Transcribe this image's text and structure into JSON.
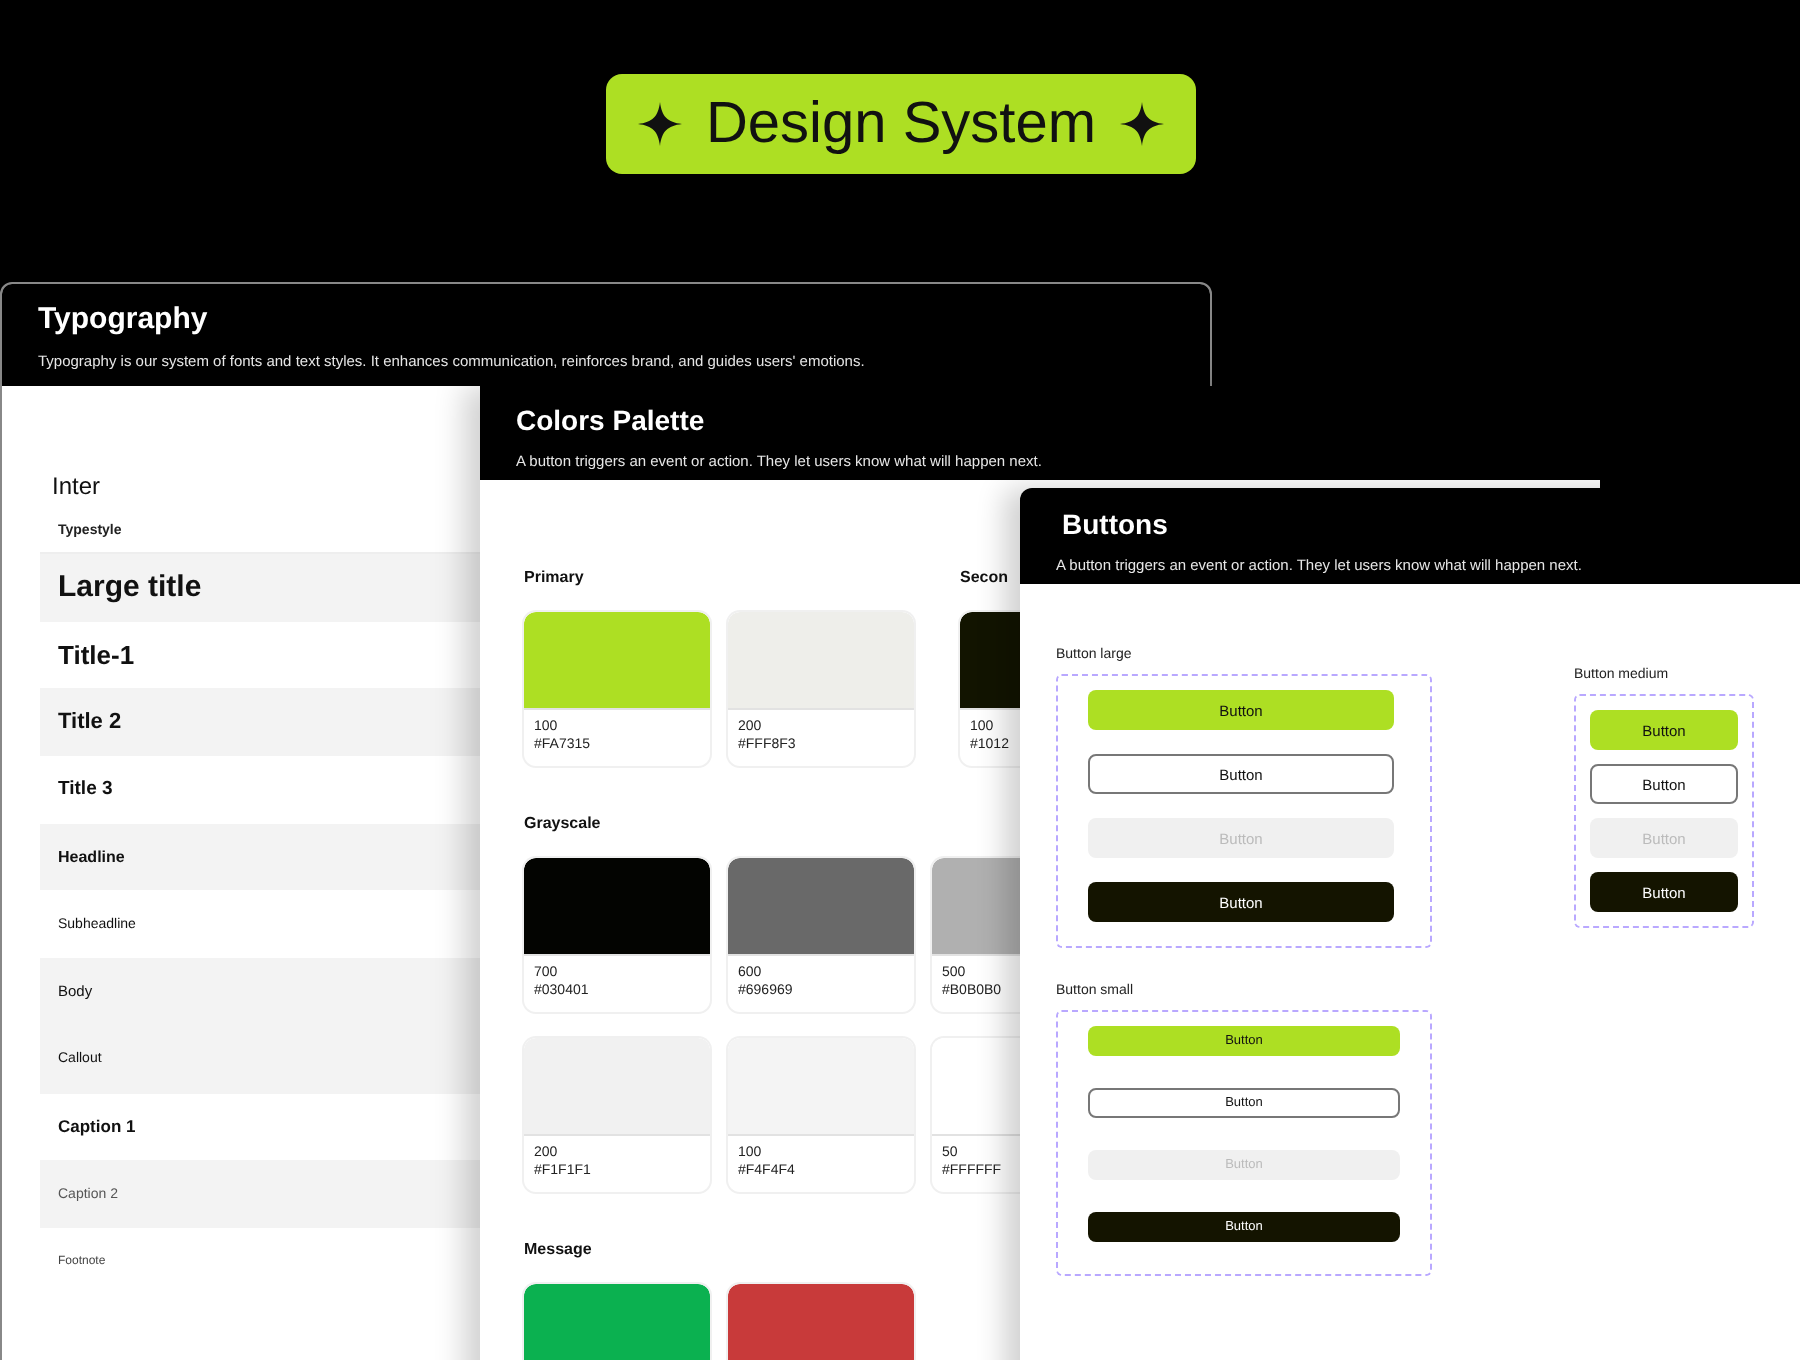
{
  "badge": {
    "title": "Design System"
  },
  "typography": {
    "title": "Typography",
    "description": "Typography is our system of fonts and text styles. It enhances communication, reinforces brand, and guides users' emotions.",
    "font_name": "Inter",
    "column_header": "Typestyle",
    "rows": [
      {
        "label": "Large title",
        "kind": "large-title",
        "shaded": true
      },
      {
        "label": "Title-1",
        "kind": "title-1",
        "shaded": false
      },
      {
        "label": "Title 2",
        "kind": "title-2",
        "shaded": true
      },
      {
        "label": "Title 3",
        "kind": "title-3",
        "shaded": false
      },
      {
        "label": "Headline",
        "kind": "headline",
        "shaded": true
      },
      {
        "label": "Subheadline",
        "kind": "subheadline",
        "shaded": false
      },
      {
        "label": "Body",
        "kind": "body",
        "shaded": true
      },
      {
        "label": "Callout",
        "kind": "callout",
        "shaded": true
      },
      {
        "label": "Caption 1",
        "kind": "caption-1",
        "shaded": false
      },
      {
        "label": "Caption 2",
        "kind": "caption-2",
        "shaded": true
      },
      {
        "label": "Footnote",
        "kind": "footnote",
        "shaded": false
      }
    ]
  },
  "colors": {
    "title": "Colors Palette",
    "description": "A button triggers an event or action. They let users know what will happen next.",
    "rows": [
      {
        "groups": [
          {
            "name": "Primary",
            "swatches": [
              {
                "shade": "100",
                "hex": "#FA7315",
                "color": "#addf23"
              },
              {
                "shade": "200",
                "hex": "#FFF8F3",
                "color": "#eeeeea"
              }
            ]
          },
          {
            "name": "Secon",
            "swatches": [
              {
                "shade": "100",
                "hex": "#1012",
                "color": "#121400"
              }
            ]
          }
        ]
      },
      {
        "groups": [
          {
            "name": "Grayscale",
            "swatches": [
              {
                "shade": "700",
                "hex": "#030401",
                "color": "#030401"
              },
              {
                "shade": "600",
                "hex": "#696969",
                "color": "#696969"
              },
              {
                "shade": "500",
                "hex": "#B0B0B0",
                "color": "#b0b0b0"
              },
              {
                "shade": "200",
                "hex": "#F1F1F1",
                "color": "#f1f1f1"
              },
              {
                "shade": "100",
                "hex": "#F4F4F4",
                "color": "#f4f4f4"
              },
              {
                "shade": "50",
                "hex": "#FFFFFF",
                "color": "#ffffff"
              }
            ]
          }
        ]
      },
      {
        "groups": [
          {
            "name": "Message",
            "swatches": [
              {
                "color": "#0bb150"
              },
              {
                "color": "#c83a3a"
              }
            ]
          }
        ]
      }
    ]
  },
  "buttons": {
    "title": "Buttons",
    "description": "A button triggers an event or action. They let users know what will happen next.",
    "columns": [
      {
        "groups": [
          {
            "label": "Button large",
            "kind": "large",
            "buttons": [
              {
                "label": "Button",
                "kind": "primary"
              },
              {
                "label": "Button",
                "kind": "outline"
              },
              {
                "label": "Button",
                "kind": "disabled"
              },
              {
                "label": "Button",
                "kind": "dark"
              }
            ]
          },
          {
            "label": "Button small",
            "kind": "small",
            "buttons": [
              {
                "label": "Button",
                "kind": "primary"
              },
              {
                "label": "Button",
                "kind": "outline"
              },
              {
                "label": "Button",
                "kind": "disabled"
              },
              {
                "label": "Button",
                "kind": "dark"
              }
            ]
          }
        ]
      },
      {
        "groups": [
          {
            "label": "Button medium",
            "kind": "medium",
            "buttons": [
              {
                "label": "Button",
                "kind": "primary"
              },
              {
                "label": "Button",
                "kind": "outline"
              },
              {
                "label": "Button",
                "kind": "disabled"
              },
              {
                "label": "Button",
                "kind": "dark"
              }
            ]
          }
        ]
      }
    ]
  }
}
